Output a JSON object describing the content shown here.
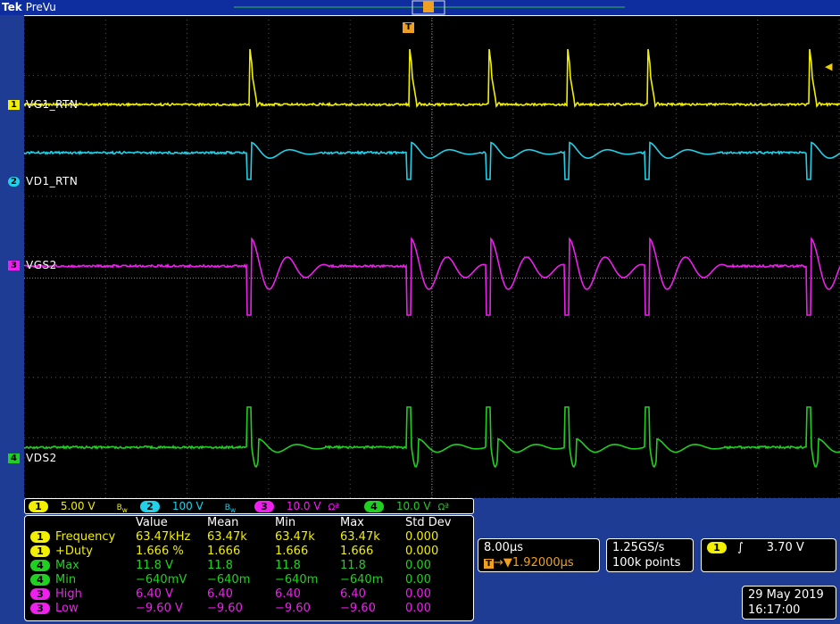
{
  "header": {
    "brand": "Tek",
    "mode": "PreVu",
    "trigger_marker": "T"
  },
  "colors": {
    "ch1": "#f2f000",
    "ch2": "#22d0e8",
    "ch3": "#ee20ee",
    "ch4": "#20d020"
  },
  "channels": [
    {
      "num": "1",
      "label": "VG1_RTN",
      "scale": "5.00 V",
      "color": "#f2f000"
    },
    {
      "num": "2",
      "label": "VD1_RTN",
      "scale": "100 V",
      "color": "#22d0e8"
    },
    {
      "num": "3",
      "label": "VGS2",
      "scale": "10.0 V",
      "color": "#ee20ee"
    },
    {
      "num": "4",
      "label": "VDS2",
      "scale": "10.0 V",
      "color": "#20d020"
    }
  ],
  "channel_strip": {
    "bw_icon": "bandwidth-icon",
    "ohm_icon": "Ωª"
  },
  "measurements": {
    "headers": [
      "Value",
      "Mean",
      "Min",
      "Max",
      "Std Dev"
    ],
    "rows": [
      {
        "ch": "1",
        "name": "Frequency",
        "value": "63.47kHz",
        "mean": "63.47k",
        "min": "63.47k",
        "max": "63.47k",
        "std": "0.000",
        "color": "#f2f000"
      },
      {
        "ch": "1",
        "name": "+Duty",
        "value": "1.666 %",
        "mean": "1.666",
        "min": "1.666",
        "max": "1.666",
        "std": "0.000",
        "color": "#f2f000"
      },
      {
        "ch": "4",
        "name": "Max",
        "value": "11.8 V",
        "mean": "11.8",
        "min": "11.8",
        "max": "11.8",
        "std": "0.00",
        "color": "#20d020"
      },
      {
        "ch": "4",
        "name": "Min",
        "value": "−640mV",
        "mean": "−640m",
        "min": "−640m",
        "max": "−640m",
        "std": "0.00",
        "color": "#20d020"
      },
      {
        "ch": "3",
        "name": "High",
        "value": "6.40 V",
        "mean": "6.40",
        "min": "6.40",
        "max": "6.40",
        "std": "0.00",
        "color": "#ee20ee"
      },
      {
        "ch": "3",
        "name": "Low",
        "value": "−9.60 V",
        "mean": "−9.60",
        "min": "−9.60",
        "max": "−9.60",
        "std": "0.00",
        "color": "#ee20ee"
      }
    ]
  },
  "timebase": {
    "scale": "8.00µs",
    "delay": "1.92000µs"
  },
  "sampling": {
    "rate": "1.25GS/s",
    "points": "100k points"
  },
  "trigger": {
    "ch": "1",
    "level": "3.70 V"
  },
  "datetime": {
    "date": "29 May 2019",
    "time": "16:17:00"
  }
}
